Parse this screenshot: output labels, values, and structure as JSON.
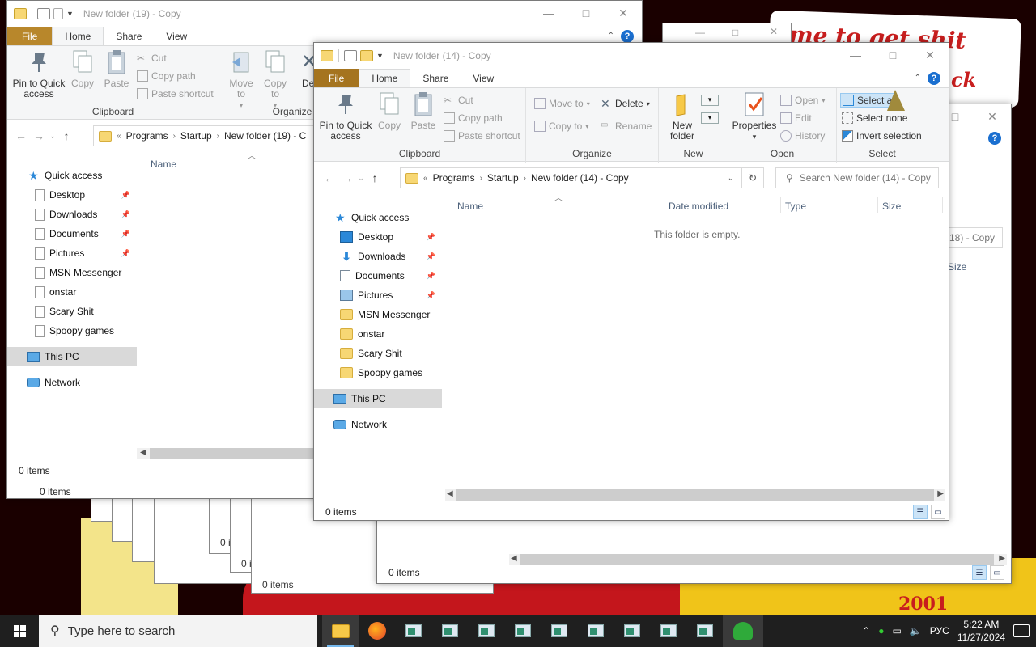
{
  "taskbar": {
    "search_placeholder": "Type here to search",
    "language": "РУС",
    "time": "5:22 AM",
    "date": "11/27/2024"
  },
  "background": {
    "meme_line1": "me to get shit",
    "meme_line2": "ck",
    "meme_year": "2001",
    "stacked_status": [
      "0 items",
      "0 items",
      "0 i"
    ]
  },
  "win19": {
    "title": "New folder (19) - Copy",
    "tabs": [
      "File",
      "Home",
      "Share",
      "View"
    ],
    "ribbon": {
      "pin": "Pin to Quick access",
      "copy": "Copy",
      "paste": "Paste",
      "cut": "Cut",
      "copy_path": "Copy path",
      "paste_shortcut": "Paste shortcut",
      "move_to": "Move to",
      "copy_to": "Copy to",
      "del": "Del",
      "clipboard": "Clipboard",
      "organize": "Organize"
    },
    "breadcrumb": [
      "Programs",
      "Startup",
      "New folder (19) - C"
    ],
    "col_name": "Name",
    "nav": {
      "quick_access": "Quick access",
      "items": [
        "Desktop",
        "Downloads",
        "Documents",
        "Pictures",
        "MSN Messenger",
        "onstar",
        "Scary Shit",
        "Spoopy games"
      ],
      "this_pc": "This PC",
      "network": "Network"
    },
    "status": "0 items",
    "status2": "0 items"
  },
  "win18": {
    "search_fragment": "(18) - Copy",
    "col_fragment": "Size",
    "status": "0 items"
  },
  "win14": {
    "title": "New folder (14) - Copy",
    "tabs": [
      "File",
      "Home",
      "Share",
      "View"
    ],
    "ribbon": {
      "pin": "Pin to Quick access",
      "copy": "Copy",
      "paste": "Paste",
      "cut": "Cut",
      "copy_path": "Copy path",
      "paste_shortcut": "Paste shortcut",
      "clipboard": "Clipboard",
      "move_to": "Move to",
      "copy_to": "Copy to",
      "delete": "Delete",
      "rename": "Rename",
      "organize": "Organize",
      "new_folder": "New folder",
      "new": "New",
      "properties": "Properties",
      "open_btn": "Open",
      "edit": "Edit",
      "history": "History",
      "open": "Open",
      "select_all": "Select a",
      "select_none": "Select none",
      "invert_selection": "Invert selection",
      "select": "Select"
    },
    "breadcrumb": [
      "Programs",
      "Startup",
      "New folder (14) - Copy"
    ],
    "search_placeholder": "Search New folder (14) - Copy",
    "columns": [
      "Name",
      "Date modified",
      "Type",
      "Size"
    ],
    "empty_message": "This folder is empty.",
    "nav": {
      "quick_access": "Quick access",
      "items": [
        "Desktop",
        "Downloads",
        "Documents",
        "Pictures",
        "MSN Messenger",
        "onstar",
        "Scary Shit",
        "Spoopy games"
      ],
      "this_pc": "This PC",
      "network": "Network"
    },
    "status": "0 items"
  }
}
